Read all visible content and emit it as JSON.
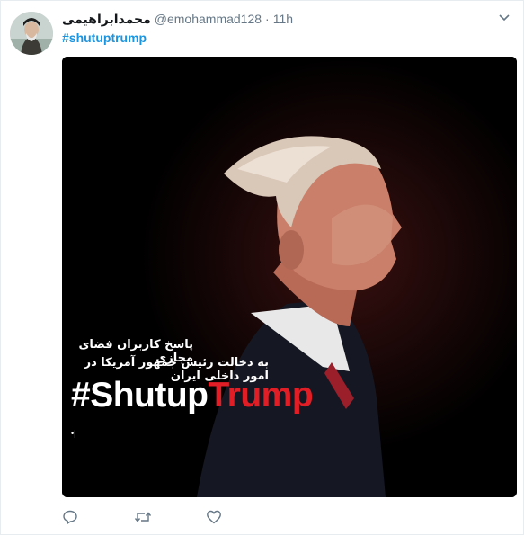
{
  "tweet": {
    "display_name": "محمدابراهیمی",
    "handle": "@emohammad128",
    "separator": "·",
    "time": "11h",
    "text": "#shutuptrump"
  },
  "media": {
    "overlay_line1": "پاسخ کاربران فضای مجازی",
    "overlay_line2": "به دخالت رئیس جمهور آمریکا در امور داخلی ایران",
    "tag_part1": "#Shutup",
    "tag_part2": "Trump",
    "corner_mark": "•|"
  },
  "icons": {
    "caret": "chevron-down-icon",
    "reply": "reply-icon",
    "retweet": "retweet-icon",
    "like": "heart-icon"
  },
  "colors": {
    "link": "#1b95e0",
    "muted": "#657786",
    "tag_red": "#e11d26"
  }
}
